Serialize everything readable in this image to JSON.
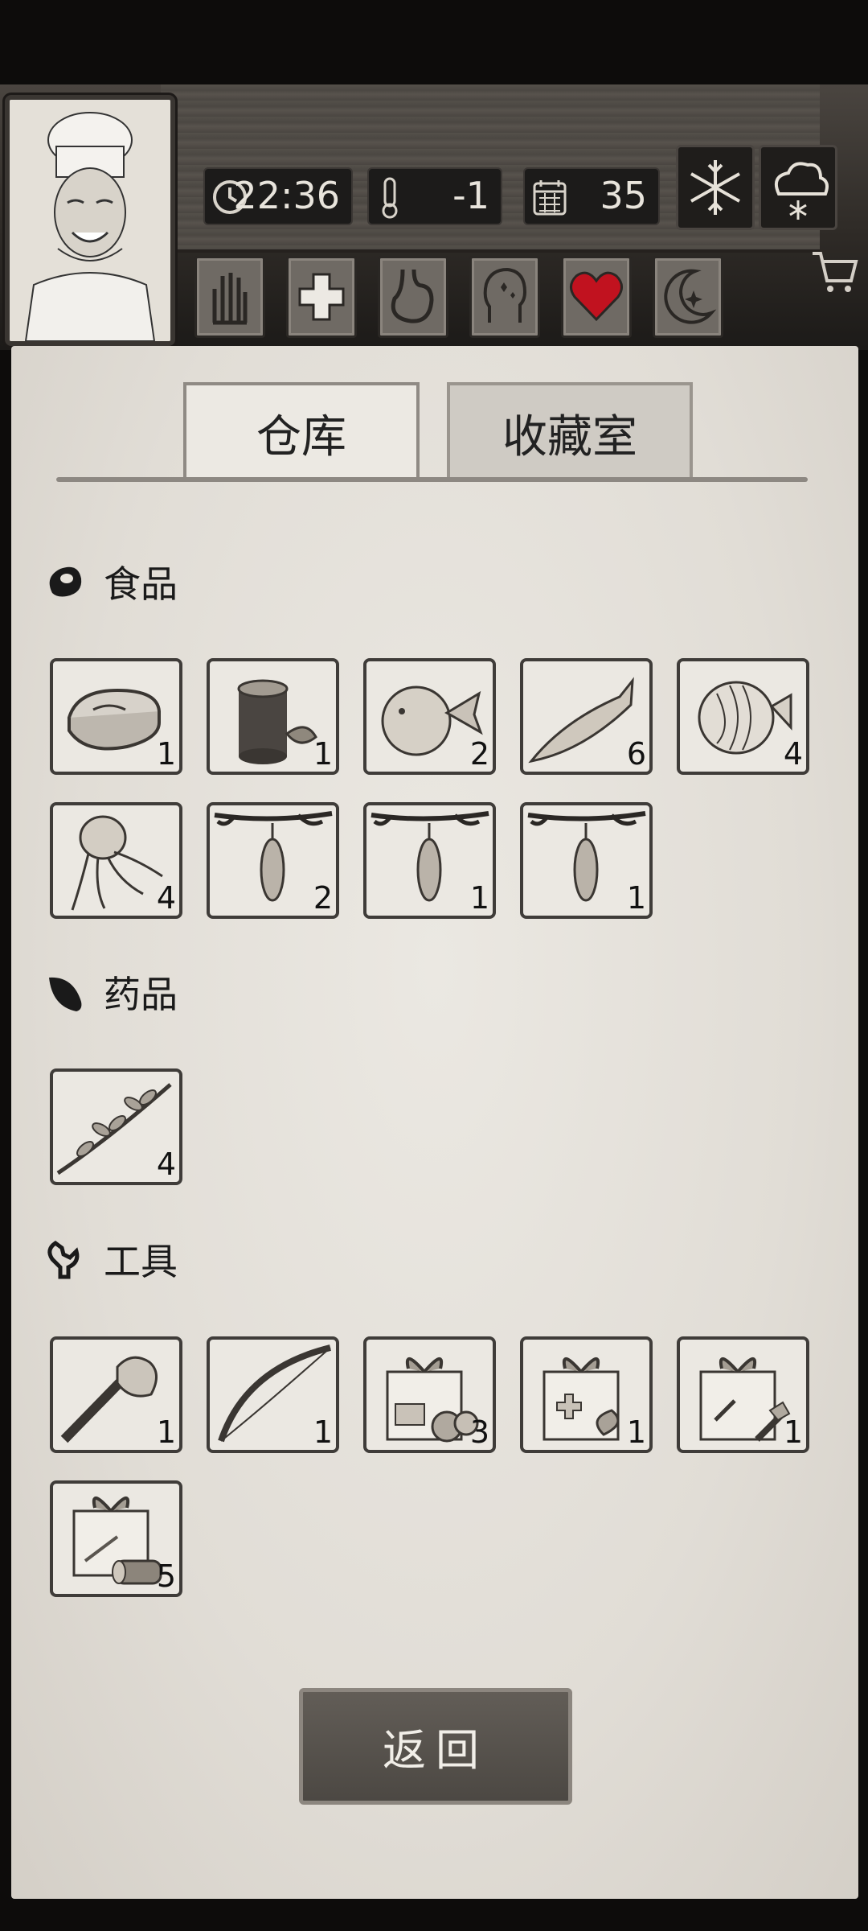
{
  "status": {
    "time": "22:36",
    "temperature": "-1",
    "day": "35"
  },
  "weather": {
    "icons": [
      "snowflake-icon",
      "snow-cloud-icon"
    ]
  },
  "stats": {
    "icons": [
      "hand-icon",
      "medical-cross-icon",
      "stomach-icon",
      "head-icon",
      "heart-icon",
      "moon-icon"
    ],
    "heart_color": "#c1121f"
  },
  "tabs": [
    {
      "label": "仓库",
      "active": true
    },
    {
      "label": "收藏室",
      "active": false
    }
  ],
  "sections": {
    "food": {
      "title": "食品",
      "icon": "meat-icon",
      "items": [
        {
          "icon": "raw-meat-icon",
          "count": "1"
        },
        {
          "icon": "tree-stump-icon",
          "count": "1"
        },
        {
          "icon": "pufferfish-icon",
          "count": "2"
        },
        {
          "icon": "salmon-icon",
          "count": "6"
        },
        {
          "icon": "butterfly-fish-icon",
          "count": "4"
        },
        {
          "icon": "octopus-icon",
          "count": "4"
        },
        {
          "icon": "hanging-fruit-icon",
          "count": "2"
        },
        {
          "icon": "hanging-fruit-icon",
          "count": "1"
        },
        {
          "icon": "hanging-fruit-icon",
          "count": "1"
        }
      ]
    },
    "medicine": {
      "title": "药品",
      "icon": "leaf-icon",
      "items": [
        {
          "icon": "herb-branch-icon",
          "count": "4"
        }
      ]
    },
    "tools": {
      "title": "工具",
      "icon": "wrench-icon",
      "items": [
        {
          "icon": "stone-axe-icon",
          "count": "1"
        },
        {
          "icon": "bow-icon",
          "count": "1"
        },
        {
          "icon": "food-gift-box-icon",
          "count": "3"
        },
        {
          "icon": "medicine-gift-box-icon",
          "count": "1"
        },
        {
          "icon": "tools-gift-box-icon",
          "count": "1"
        },
        {
          "icon": "wood-gift-box-icon",
          "count": "5"
        }
      ]
    }
  },
  "back_button": "返回"
}
